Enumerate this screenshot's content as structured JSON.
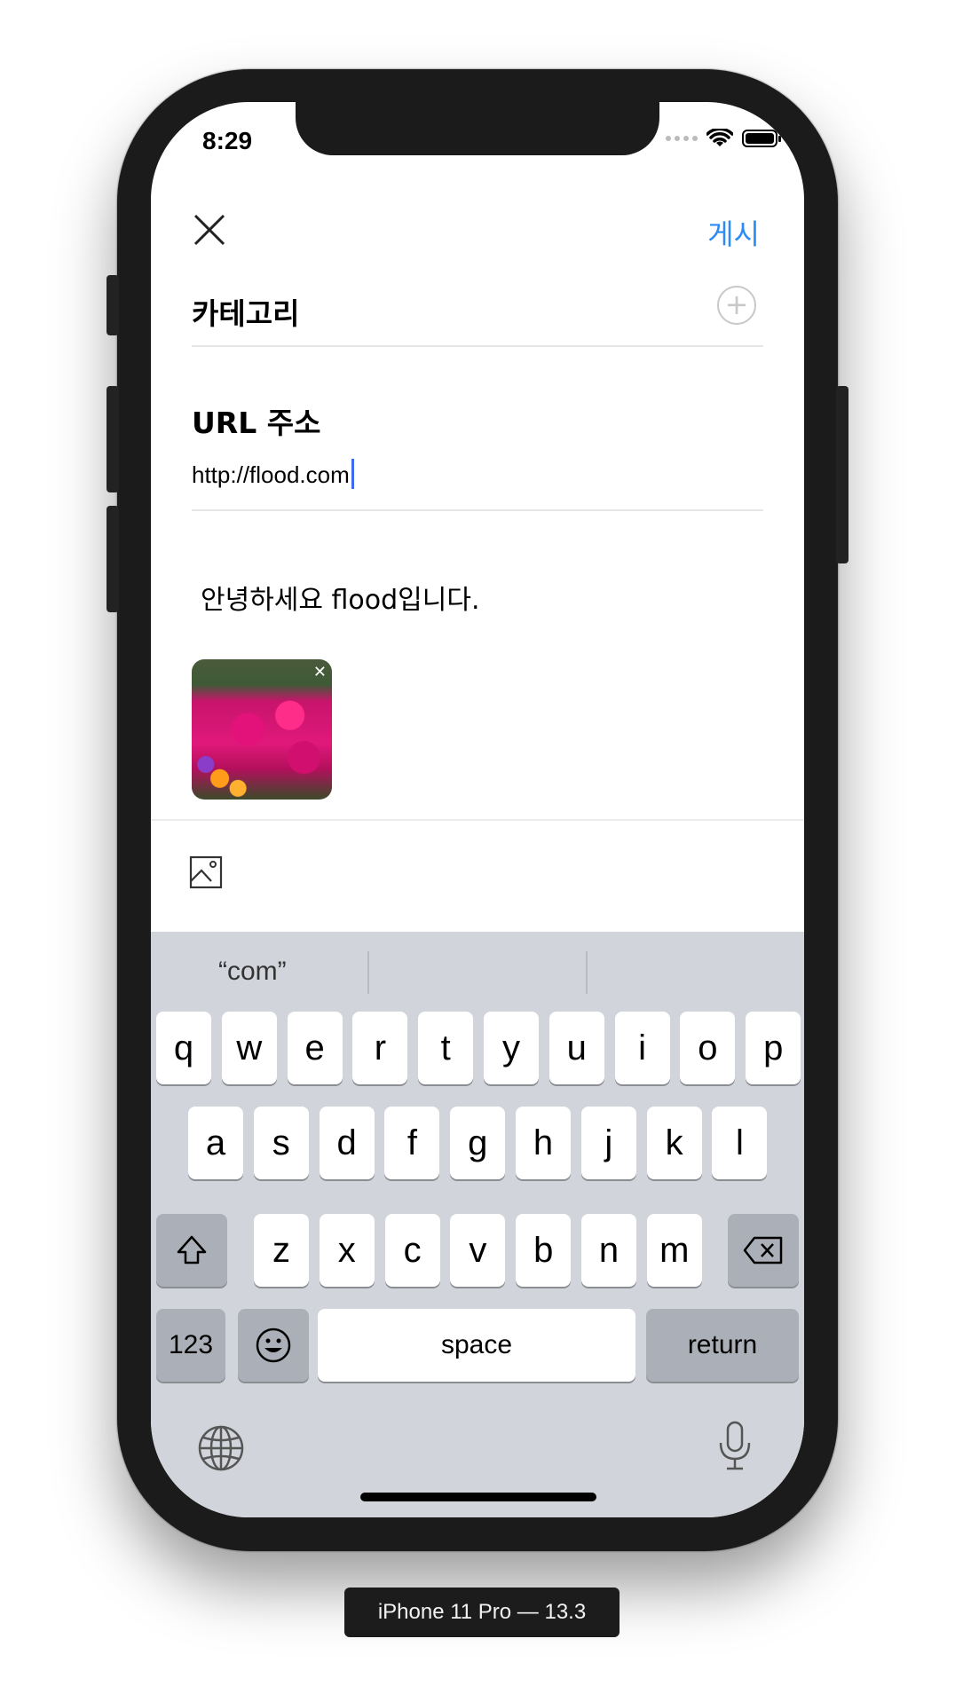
{
  "status": {
    "time": "8:29"
  },
  "nav": {
    "post_label": "게시"
  },
  "category": {
    "label": "카테고리",
    "add_icon": "plus-circle-icon"
  },
  "url": {
    "label": "URL 주소",
    "value": "http://flood.com"
  },
  "content": {
    "text": "안녕하세요 flood입니다."
  },
  "keyboard": {
    "suggestion": "“com”",
    "row1": [
      "q",
      "w",
      "e",
      "r",
      "t",
      "y",
      "u",
      "i",
      "o",
      "p"
    ],
    "row2": [
      "a",
      "s",
      "d",
      "f",
      "g",
      "h",
      "j",
      "k",
      "l"
    ],
    "row3": [
      "z",
      "x",
      "c",
      "v",
      "b",
      "n",
      "m"
    ],
    "numbers_label": "123",
    "space_label": "space",
    "return_label": "return"
  },
  "device_label": "iPhone 11 Pro — 13.3",
  "colors": {
    "accent": "#2a8af6",
    "caret": "#3e6bf2",
    "keyboard_bg": "#d1d4da"
  }
}
